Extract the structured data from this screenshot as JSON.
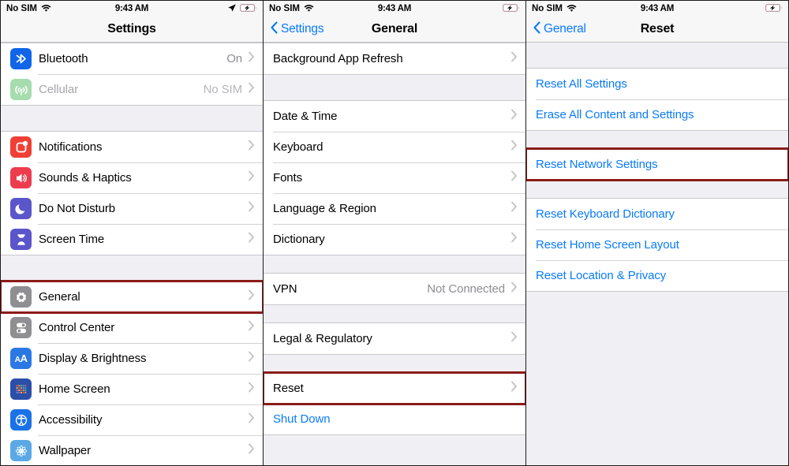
{
  "colors": {
    "highlight": "#8a1c18",
    "link": "#0a7bf9",
    "group_bg": "#efeff4",
    "row_bg": "#ffffff",
    "separator": "#d3d3d6"
  },
  "panels": [
    {
      "id": "settings",
      "status": {
        "carrier": "No SIM",
        "wifi_icon": "wifi-icon",
        "time": "9:43 AM",
        "location_icon": "location-arrow-icon",
        "battery_icon": "battery-charging-icon"
      },
      "nav": {
        "title": "Settings",
        "back_label": "",
        "has_back": false
      },
      "groups": [
        {
          "top_gap": "none",
          "rows": [
            {
              "label": "Bluetooth",
              "value": "On",
              "icon": "bluetooth-icon",
              "icon_color": "#1065e8",
              "chevron": true,
              "disabled": false
            },
            {
              "label": "Cellular",
              "value": "No SIM",
              "icon": "cellular-icon",
              "icon_color": "#9ad7a0",
              "chevron": true,
              "disabled": true
            }
          ]
        },
        {
          "top_gap": "large",
          "rows": [
            {
              "label": "Notifications",
              "value": "",
              "icon": "notifications-icon",
              "icon_color": "#f03f35",
              "chevron": true,
              "disabled": false
            },
            {
              "label": "Sounds & Haptics",
              "value": "",
              "icon": "sounds-haptics-icon",
              "icon_color": "#ec3c4e",
              "chevron": true,
              "disabled": false
            },
            {
              "label": "Do Not Disturb",
              "value": "",
              "icon": "do-not-disturb-icon",
              "icon_color": "#5a55ca",
              "chevron": true,
              "disabled": false
            },
            {
              "label": "Screen Time",
              "value": "",
              "icon": "screen-time-icon",
              "icon_color": "#5a55ca",
              "chevron": true,
              "disabled": false
            }
          ]
        },
        {
          "top_gap": "large",
          "rows": [
            {
              "label": "General",
              "value": "",
              "icon": "gear-icon",
              "icon_color": "#8e8e93",
              "chevron": true,
              "disabled": false,
              "highlighted": true
            },
            {
              "label": "Control Center",
              "value": "",
              "icon": "control-center-icon",
              "icon_color": "#8e8e93",
              "chevron": true,
              "disabled": false
            },
            {
              "label": "Display & Brightness",
              "value": "",
              "icon": "display-brightness-icon",
              "icon_color": "#2b78e4",
              "chevron": true,
              "disabled": false
            },
            {
              "label": "Home Screen",
              "value": "",
              "icon": "home-screen-icon",
              "icon_color": "#2b4fa8",
              "chevron": true,
              "disabled": false
            },
            {
              "label": "Accessibility",
              "value": "",
              "icon": "accessibility-icon",
              "icon_color": "#1b72e8",
              "chevron": true,
              "disabled": false
            },
            {
              "label": "Wallpaper",
              "value": "",
              "icon": "wallpaper-icon",
              "icon_color": "#5aa9e6",
              "chevron": true,
              "disabled": false
            }
          ]
        }
      ]
    },
    {
      "id": "general",
      "status": {
        "carrier": "No SIM",
        "wifi_icon": "wifi-icon",
        "time": "9:43 AM",
        "location_icon": "",
        "battery_icon": "battery-charging-icon"
      },
      "nav": {
        "title": "General",
        "back_label": "Settings",
        "has_back": true
      },
      "groups": [
        {
          "top_gap": "none",
          "rows": [
            {
              "label": "Background App Refresh",
              "value": "",
              "icon": "",
              "chevron": true,
              "disabled": false
            }
          ]
        },
        {
          "top_gap": "large",
          "rows": [
            {
              "label": "Date & Time",
              "value": "",
              "icon": "",
              "chevron": true,
              "disabled": false
            },
            {
              "label": "Keyboard",
              "value": "",
              "icon": "",
              "chevron": true,
              "disabled": false
            },
            {
              "label": "Fonts",
              "value": "",
              "icon": "",
              "chevron": true,
              "disabled": false
            },
            {
              "label": "Language & Region",
              "value": "",
              "icon": "",
              "chevron": true,
              "disabled": false
            },
            {
              "label": "Dictionary",
              "value": "",
              "icon": "",
              "chevron": true,
              "disabled": false
            }
          ]
        },
        {
          "top_gap": "small",
          "rows": [
            {
              "label": "VPN",
              "value": "Not Connected",
              "icon": "",
              "chevron": true,
              "disabled": false
            }
          ]
        },
        {
          "top_gap": "small",
          "rows": [
            {
              "label": "Legal & Regulatory",
              "value": "",
              "icon": "",
              "chevron": true,
              "disabled": false
            }
          ]
        },
        {
          "top_gap": "small",
          "rows": [
            {
              "label": "Reset",
              "value": "",
              "icon": "",
              "chevron": true,
              "disabled": false,
              "highlighted": true
            },
            {
              "label": "Shut Down",
              "value": "",
              "icon": "",
              "chevron": false,
              "disabled": false,
              "link": true
            }
          ]
        }
      ]
    },
    {
      "id": "reset",
      "status": {
        "carrier": "No SIM",
        "wifi_icon": "wifi-icon",
        "time": "9:43 AM",
        "location_icon": "",
        "battery_icon": "battery-charging-icon"
      },
      "nav": {
        "title": "Reset",
        "back_label": "General",
        "has_back": true
      },
      "groups": [
        {
          "top_gap": "large",
          "rows": [
            {
              "label": "Reset All Settings",
              "value": "",
              "icon": "",
              "chevron": false,
              "disabled": false,
              "link": true
            },
            {
              "label": "Erase All Content and Settings",
              "value": "",
              "icon": "",
              "chevron": false,
              "disabled": false,
              "link": true
            }
          ]
        },
        {
          "top_gap": "small",
          "rows": [
            {
              "label": "Reset Network Settings",
              "value": "",
              "icon": "",
              "chevron": false,
              "disabled": false,
              "link": true,
              "highlighted": true
            }
          ]
        },
        {
          "top_gap": "small",
          "rows": [
            {
              "label": "Reset Keyboard Dictionary",
              "value": "",
              "icon": "",
              "chevron": false,
              "disabled": false,
              "link": true
            },
            {
              "label": "Reset Home Screen Layout",
              "value": "",
              "icon": "",
              "chevron": false,
              "disabled": false,
              "link": true
            },
            {
              "label": "Reset Location & Privacy",
              "value": "",
              "icon": "",
              "chevron": false,
              "disabled": false,
              "link": true
            }
          ]
        }
      ]
    }
  ]
}
